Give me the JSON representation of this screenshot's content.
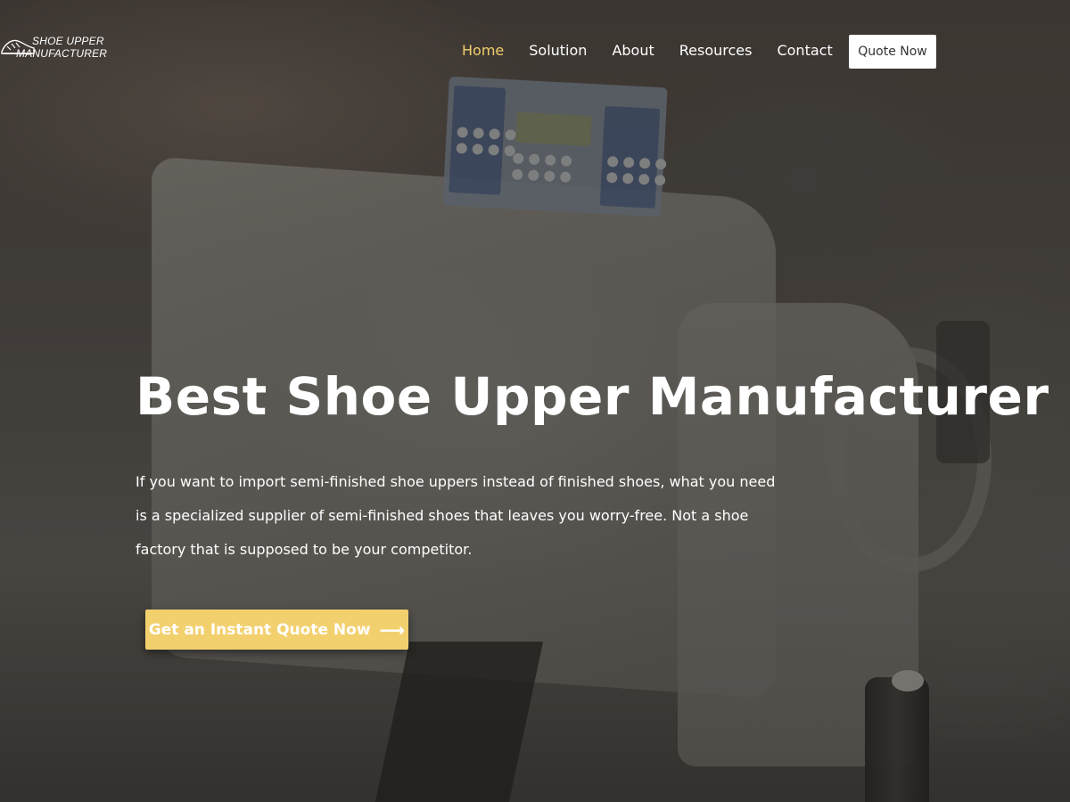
{
  "logo": {
    "line1": "SHOE UPPER",
    "line2": "MANUFACTURER",
    "icon": "shoe-logo-icon"
  },
  "nav": {
    "items": [
      {
        "label": "Home",
        "active": true
      },
      {
        "label": "Solution",
        "active": false
      },
      {
        "label": "About",
        "active": false
      },
      {
        "label": "Resources",
        "active": false
      },
      {
        "label": "Contact",
        "active": false
      }
    ],
    "quote_label": "Quote Now"
  },
  "hero": {
    "title": "Best Shoe Upper Manufacturer",
    "description": "If you want to import semi-finished shoe uppers instead of finished shoes, what you need is a specialized supplier of semi-finished shoes that leaves you worry-free. Not a shoe factory that is supposed to be your competitor.",
    "cta_label": "Get an Instant Quote Now",
    "cta_icon": "arrow-right-icon"
  },
  "colors": {
    "accent": "#f3d06e",
    "nav_active": "#f2cf6a",
    "text": "#ffffff"
  }
}
